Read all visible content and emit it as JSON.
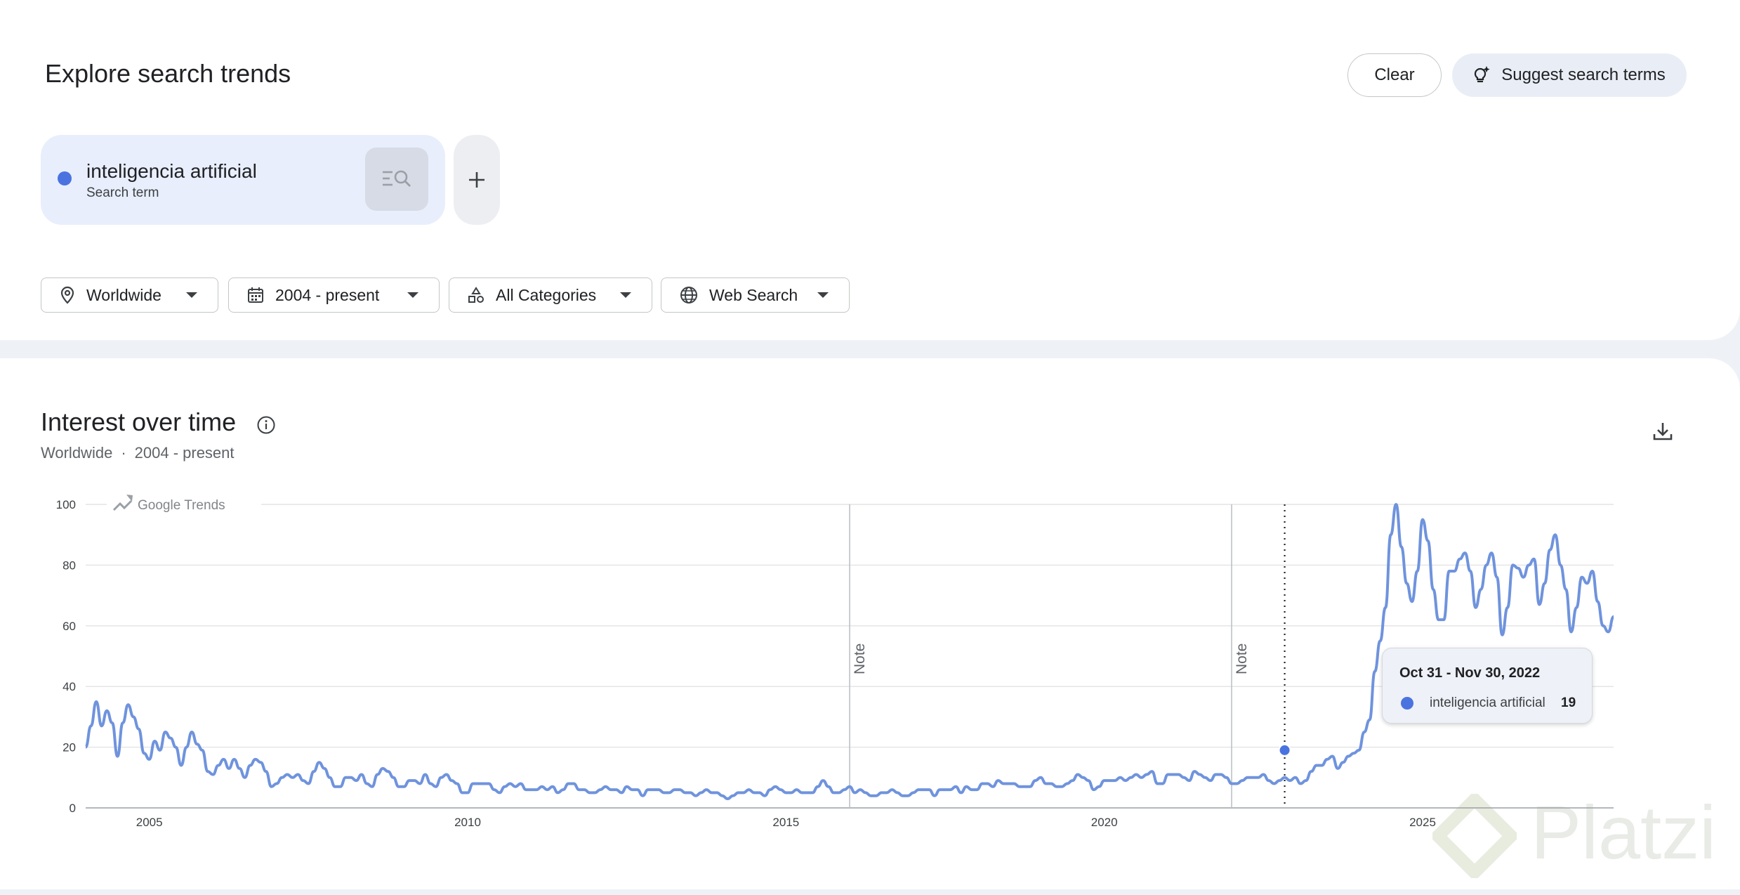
{
  "header": {
    "title": "Explore search trends",
    "clear_label": "Clear",
    "suggest_label": "Suggest search terms"
  },
  "terms": [
    {
      "name": "inteligencia artificial",
      "type": "Search term",
      "color": "#4a73e0"
    }
  ],
  "filters": {
    "region": "Worldwide",
    "time": "2004 - present",
    "category": "All Categories",
    "property": "Web Search"
  },
  "section": {
    "title": "Interest over time",
    "subtitle_region": "Worldwide",
    "subtitle_sep": "·",
    "subtitle_time": "2004 - present"
  },
  "tooltip": {
    "date": "Oct 31 - Nov 30, 2022",
    "term": "inteligencia artificial",
    "value": "19"
  },
  "watermark": "Platzi",
  "chart_data": {
    "type": "line",
    "source_label": "Google Trends",
    "x_start": "2004-01",
    "x_ticks": [
      "2005",
      "2010",
      "2015",
      "2020",
      "2025"
    ],
    "y_ticks": [
      "0",
      "20",
      "40",
      "60",
      "80",
      "100"
    ],
    "ylim": [
      0,
      100
    ],
    "grid": true,
    "notes": [
      {
        "label": "Note",
        "date": "2016-01"
      },
      {
        "label": "Note",
        "date": "2022-01"
      }
    ],
    "highlight": {
      "date": "2022-11",
      "value": 19
    },
    "series": [
      {
        "name": "inteligencia artificial",
        "color": "#6f93dd",
        "values": [
          20,
          27,
          35,
          27,
          32,
          28,
          17,
          28,
          34,
          30,
          26,
          18,
          16,
          22,
          19,
          25,
          23,
          20,
          14,
          20,
          25,
          21,
          19,
          12,
          11,
          14,
          16,
          13,
          16,
          13,
          10,
          14,
          16,
          15,
          12,
          7,
          8,
          10,
          11,
          10,
          11,
          9,
          8,
          12,
          15,
          13,
          10,
          7,
          7,
          10,
          10,
          9,
          11,
          8,
          7,
          11,
          13,
          12,
          10,
          7,
          7,
          9,
          9,
          8,
          11,
          8,
          7,
          10,
          11,
          9,
          8,
          5,
          5,
          8,
          8,
          8,
          8,
          6,
          5,
          7,
          8,
          7,
          8,
          6,
          6,
          6,
          7,
          6,
          7,
          5,
          6,
          8,
          8,
          6,
          6,
          5,
          5,
          6,
          7,
          6,
          6,
          5,
          7,
          6,
          6,
          4,
          6,
          6,
          6,
          5,
          5,
          6,
          6,
          5,
          5,
          4,
          5,
          6,
          5,
          5,
          4,
          3,
          4,
          5,
          5,
          6,
          5,
          5,
          4,
          6,
          7,
          6,
          5,
          5,
          6,
          5,
          5,
          5,
          7,
          9,
          7,
          5,
          5,
          6,
          7,
          5,
          6,
          5,
          4,
          4,
          5,
          5,
          6,
          5,
          4,
          4,
          5,
          6,
          6,
          6,
          4,
          6,
          6,
          6,
          7,
          5,
          7,
          6,
          6,
          8,
          8,
          7,
          9,
          8,
          8,
          8,
          7,
          7,
          7,
          9,
          10,
          8,
          8,
          7,
          7,
          8,
          9,
          11,
          10,
          9,
          6,
          7,
          9,
          9,
          9,
          10,
          9,
          10,
          11,
          10,
          11,
          12,
          8,
          8,
          11,
          11,
          11,
          10,
          9,
          12,
          11,
          10,
          9,
          11,
          11,
          10,
          8,
          8,
          9,
          10,
          10,
          10,
          11,
          9,
          8,
          9,
          10,
          9,
          10,
          8,
          9,
          12,
          14,
          14,
          16,
          17,
          13,
          15,
          17,
          18,
          19,
          25,
          29,
          45,
          55,
          66,
          90,
          100,
          86,
          74,
          68,
          78,
          95,
          88,
          72,
          62,
          62,
          78,
          78,
          82,
          84,
          78,
          66,
          72,
          80,
          84,
          76,
          57,
          66,
          80,
          79,
          76,
          80,
          82,
          67,
          74,
          85,
          90,
          80,
          72,
          58,
          66,
          76,
          74,
          78,
          68,
          60,
          58,
          63
        ]
      }
    ]
  }
}
